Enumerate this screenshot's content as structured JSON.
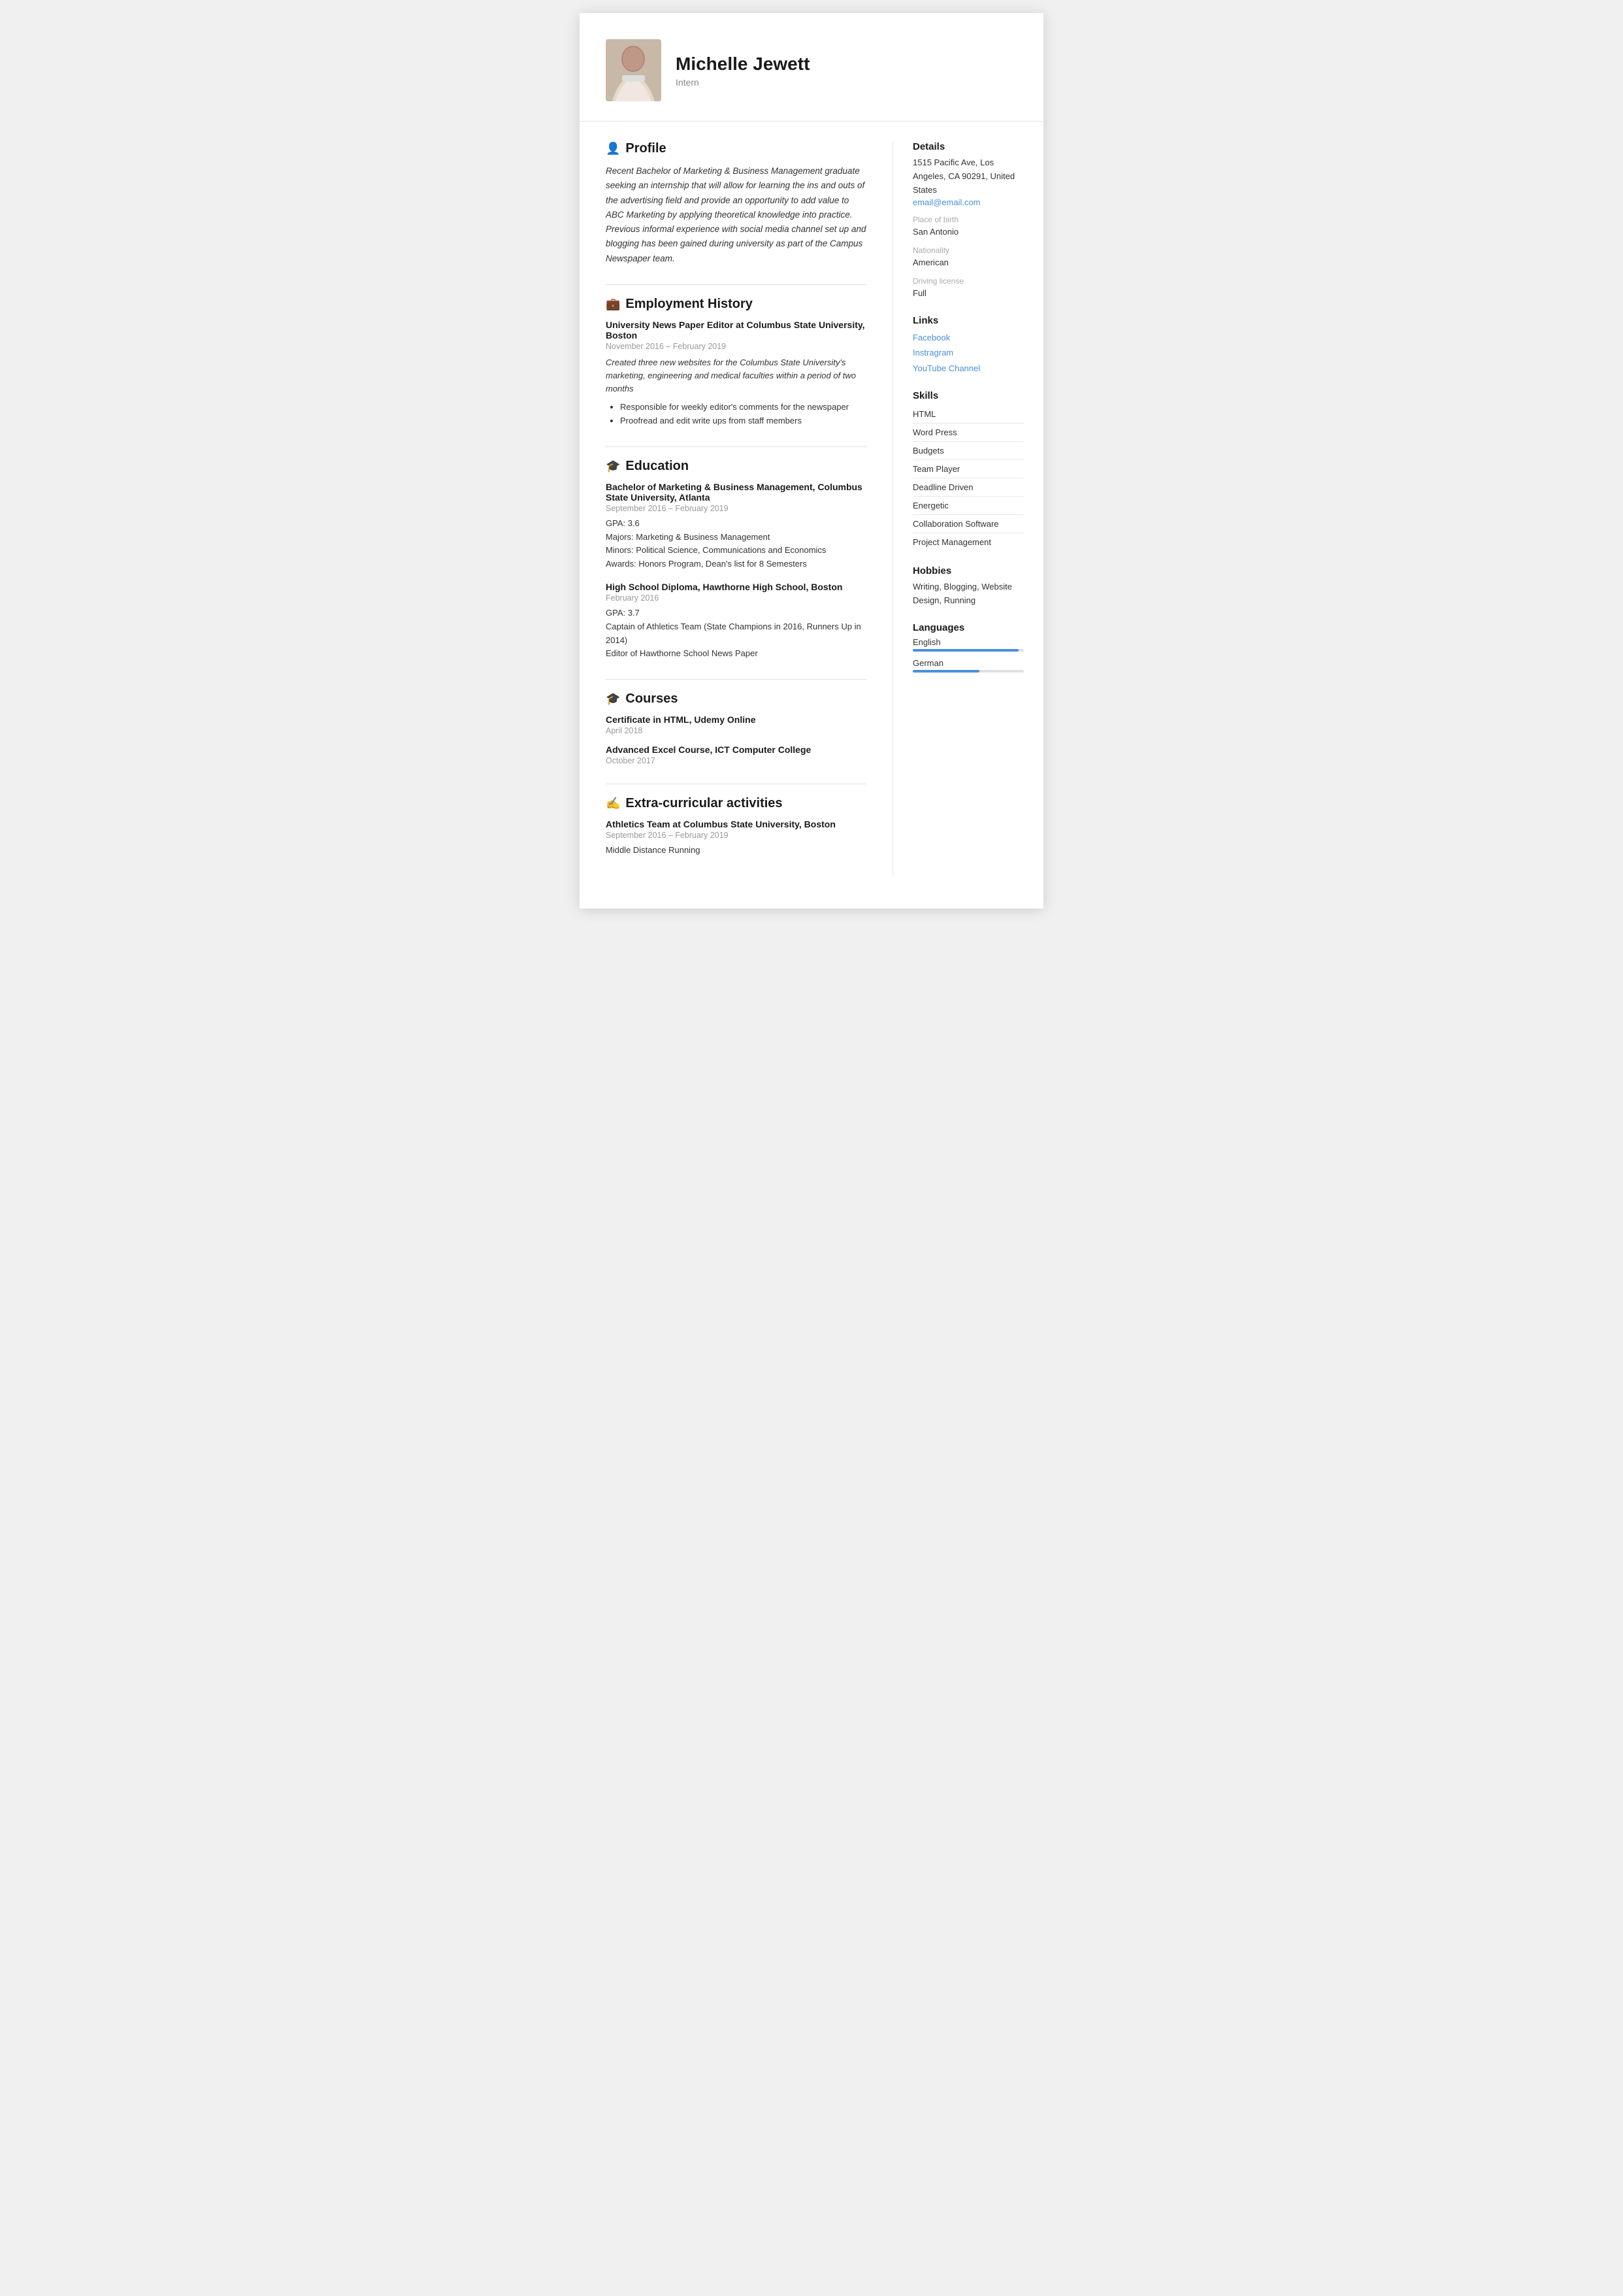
{
  "header": {
    "name": "Michelle Jewett",
    "subtitle": "Intern"
  },
  "profile": {
    "section_title": "Profile",
    "text": "Recent Bachelor of Marketing & Business Management graduate seeking an internship that will allow for learning the ins and outs of the advertising field and provide an opportunity to add value to ABC Marketing by applying theoretical knowledge into practice. Previous informal experience with social media channel set up and blogging has been gained during university as part of the Campus Newspaper team."
  },
  "employment": {
    "section_title": "Employment History",
    "jobs": [
      {
        "title": "University News Paper Editor at Columbus State University, Boston",
        "dates": "November 2016 – February 2019",
        "desc": "Created three new websites for the Columbus State University's marketing, engineering and medical faculties within a period of two months",
        "bullets": [
          "Responsible for weekly editor's comments for the newspaper",
          "Proofread and edit write ups from staff members"
        ]
      }
    ]
  },
  "education": {
    "section_title": "Education",
    "items": [
      {
        "title": "Bachelor of Marketing & Business Management, Columbus State University, Atlanta",
        "dates": "September 2016 – February 2019",
        "details": [
          "GPA: 3.6",
          "Majors: Marketing & Business Management",
          "Minors: Political Science, Communications and Economics",
          "Awards: Honors Program, Dean's list for 8 Semesters"
        ]
      },
      {
        "title": "High School Diploma, Hawthorne High School, Boston",
        "dates": "February 2016",
        "details": [
          "GPA: 3.7",
          "Captain of Athletics Team (State Champions in 2016, Runners Up in 2014)",
          "Editor of Hawthorne School News Paper"
        ]
      }
    ]
  },
  "courses": {
    "section_title": "Courses",
    "items": [
      {
        "title": "Certificate in HTML, Udemy Online",
        "dates": "April 2018"
      },
      {
        "title": "Advanced Excel Course, ICT Computer College",
        "dates": "October 2017"
      }
    ]
  },
  "extracurricular": {
    "section_title": "Extra-curricular activities",
    "items": [
      {
        "title": "Athletics Team at Columbus State University, Boston",
        "dates": "September 2016 – February 2019",
        "details": [
          "Middle Distance Running"
        ]
      }
    ]
  },
  "details": {
    "section_title": "Details",
    "address": "1515 Pacific Ave, Los Angeles, CA 90291, United States",
    "email": "email@email.com",
    "place_of_birth_label": "Place of birth",
    "place_of_birth": "San Antonio",
    "nationality_label": "Nationality",
    "nationality": "American",
    "driving_license_label": "Driving license",
    "driving_license": "Full"
  },
  "links": {
    "section_title": "Links",
    "items": [
      {
        "label": "Facebook",
        "url": "#"
      },
      {
        "label": "Instragram",
        "url": "#"
      },
      {
        "label": "YouTube Channel",
        "url": "#"
      }
    ]
  },
  "skills": {
    "section_title": "Skills",
    "items": [
      "HTML",
      "Word Press",
      "Budgets",
      "Team Player",
      "Deadline Driven",
      "Energetic",
      "Collaboration Software",
      "Project Management"
    ]
  },
  "hobbies": {
    "section_title": "Hobbies",
    "text": "Writing, Blogging, Website Design, Running"
  },
  "languages": {
    "section_title": "Languages",
    "items": [
      {
        "name": "English",
        "level": 95
      },
      {
        "name": "German",
        "level": 60
      }
    ]
  }
}
